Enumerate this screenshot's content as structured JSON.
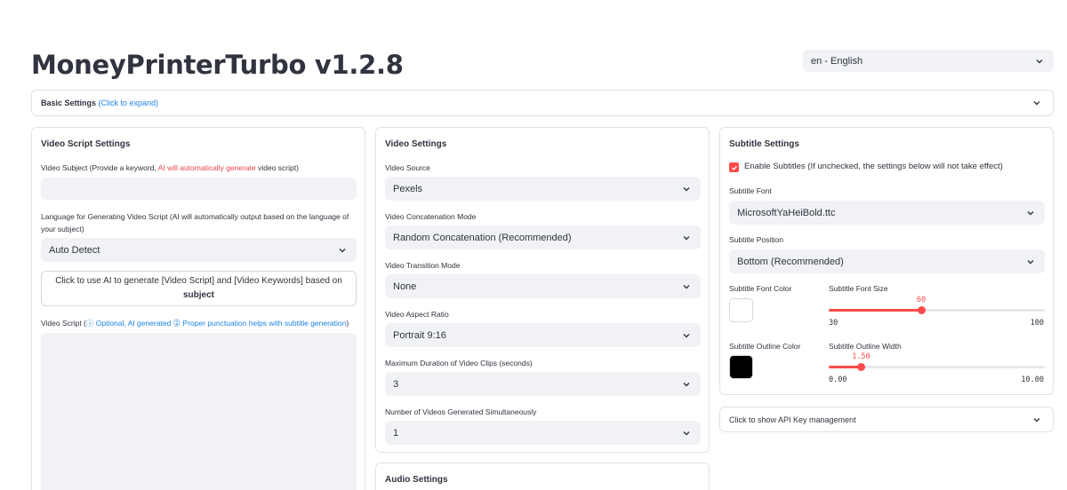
{
  "app": {
    "title": "MoneyPrinterTurbo v1.2.8"
  },
  "language": {
    "selected": "en - English"
  },
  "basic_settings": {
    "label": "Basic Settings",
    "hint": "(Click to expand)"
  },
  "script_panel": {
    "title": "Video Script Settings",
    "subject_label_pre": "Video Subject (Provide a keyword, ",
    "subject_label_red": "AI will automatically generate",
    "subject_label_post": " video script)",
    "subject_value": "",
    "lang_label": "Language for Generating Video Script (AI will automatically output based on the language of your subject)",
    "lang_selected": "Auto Detect",
    "generate_button_line1": "Click to use AI to generate [Video Script] and [Video Keywords] based on",
    "generate_button_line2": "subject",
    "script_label_pre": "Video Script (",
    "script_label_hint": "ⓘ Optional, AI generated ⓶ Proper punctuation helps with subtitle generation",
    "script_label_post": ")",
    "script_value": ""
  },
  "video_panel": {
    "title": "Video Settings",
    "fields": [
      {
        "label": "Video Source",
        "value": "Pexels"
      },
      {
        "label": "Video Concatenation Mode",
        "value": "Random Concatenation (Recommended)"
      },
      {
        "label": "Video Transition Mode",
        "value": "None"
      },
      {
        "label": "Video Aspect Ratio",
        "value": "Portrait 9:16"
      },
      {
        "label": "Maximum Duration of Video Clips (seconds)",
        "value": "3"
      },
      {
        "label": "Number of Videos Generated Simultaneously",
        "value": "1"
      }
    ]
  },
  "audio_panel": {
    "title": "Audio Settings"
  },
  "subtitle_panel": {
    "title": "Subtitle Settings",
    "enable_label": "Enable Subtitles (If unchecked, the settings below will not take effect)",
    "enabled": true,
    "font_label": "Subtitle Font",
    "font_value": "MicrosoftYaHeiBold.ttc",
    "position_label": "Subtitle Position",
    "position_value": "Bottom (Recommended)",
    "font_color_label": "Subtitle Font Color",
    "font_color": "#ffffff",
    "font_size_label": "Subtitle Font Size",
    "font_size": {
      "value": "60",
      "min": "30",
      "max": "100",
      "fraction": 0.4286
    },
    "outline_color_label": "Subtitle Outline Color",
    "outline_color": "#000000",
    "outline_width_label": "Subtitle Outline Width",
    "outline_width": {
      "value": "1.50",
      "min": "0.00",
      "max": "10.00",
      "fraction": 0.15
    }
  },
  "api_key": {
    "label": "Click to show API Key management"
  },
  "colors": {
    "accent": "#ff4b4b",
    "link": "#1c83e1",
    "input_bg": "#f0f2f6"
  }
}
